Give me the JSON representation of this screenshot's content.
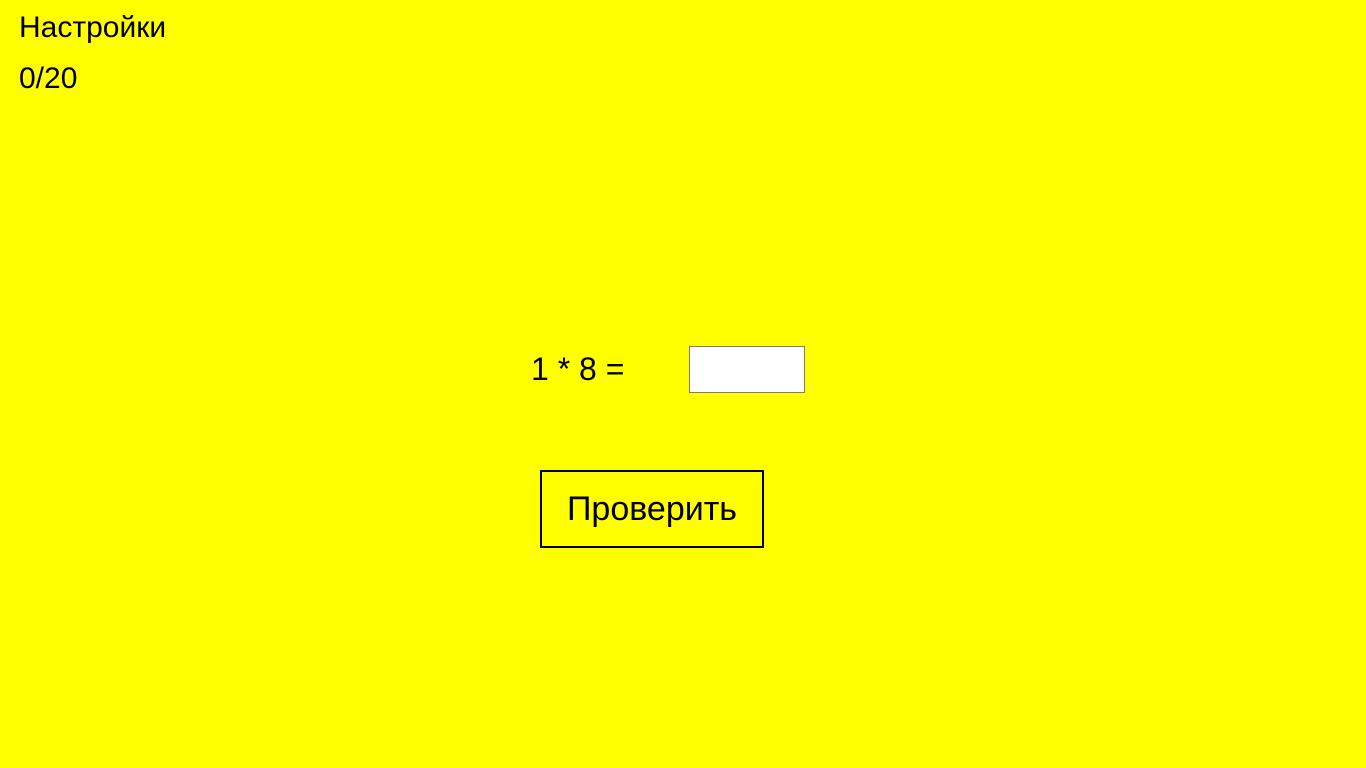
{
  "header": {
    "settings_label": "Настройки",
    "score": "0/20"
  },
  "quiz": {
    "question": "1 * 8 =",
    "answer_value": "",
    "check_label": "Проверить"
  },
  "colors": {
    "background": "#ffff00",
    "text": "#000000",
    "input_background": "#ffffff"
  }
}
